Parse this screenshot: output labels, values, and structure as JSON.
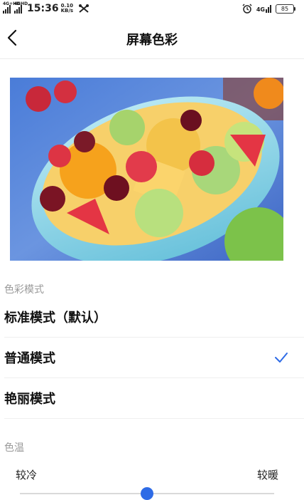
{
  "status_bar": {
    "network_1": "4G+HD",
    "network_2": "4GHD",
    "time": "15:36",
    "speed_value": "0.10",
    "speed_unit": "KB/s",
    "net_type": "4G",
    "battery": "85"
  },
  "header": {
    "title": "屏幕色彩"
  },
  "color_mode": {
    "section_label": "色彩模式",
    "options": [
      {
        "label": "标准模式（默认）",
        "selected": false
      },
      {
        "label": "普通模式",
        "selected": true
      },
      {
        "label": "艳丽模式",
        "selected": false
      }
    ]
  },
  "color_temp": {
    "section_label": "色温",
    "cool_label": "较冷",
    "warm_label": "较暖",
    "slider_value": 0.5
  },
  "colors": {
    "accent": "#2e6be6",
    "bowl": "#8fd3e6",
    "background": "#ffffff"
  }
}
